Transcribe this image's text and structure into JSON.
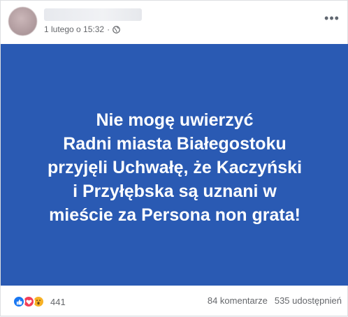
{
  "post": {
    "author_name": "",
    "timestamp": "1 lutego o 15:32",
    "separator": "·",
    "more_label": "•••"
  },
  "image": {
    "background_color": "#2a5ab3",
    "text_color": "#ffffff",
    "lines": [
      "Nie mogę uwierzyć",
      "Radni miasta Białegostoku",
      "przyjęli Uchwałę, że Kaczyński",
      "i Przyłębska są uznani w",
      "mieście za Persona non grata!"
    ]
  },
  "footer": {
    "reactions": [
      "like",
      "love",
      "wow"
    ],
    "reaction_count": "441",
    "comments": "84 komentarze",
    "shares": "535 udostępnień"
  }
}
